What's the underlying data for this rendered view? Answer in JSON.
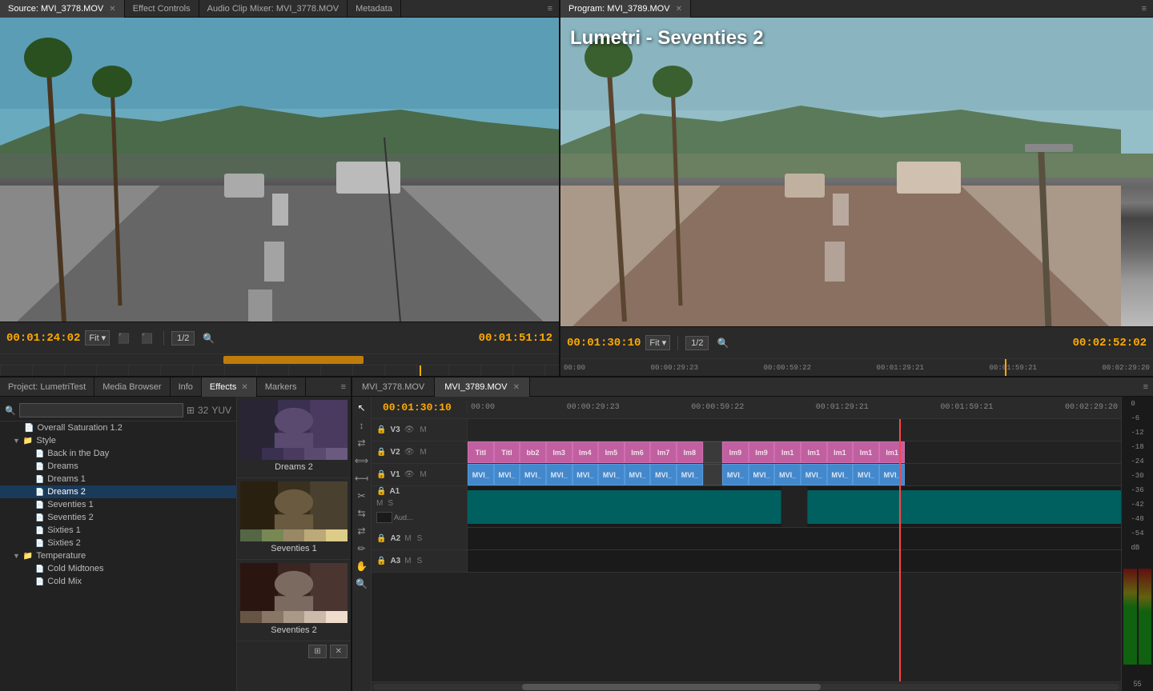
{
  "source_monitor": {
    "tabs": [
      {
        "label": "Source: MVI_3778.MOV",
        "active": true,
        "closeable": true
      },
      {
        "label": "Effect Controls",
        "active": false,
        "closeable": false
      },
      {
        "label": "Audio Clip Mixer: MVI_3778.MOV",
        "active": false,
        "closeable": false
      },
      {
        "label": "Metadata",
        "active": false,
        "closeable": false
      }
    ],
    "timecode_left": "00:01:24:02",
    "fit_label": "Fit",
    "fraction": "1/2",
    "timecode_right": "00:01:51:12"
  },
  "program_monitor": {
    "tabs": [
      {
        "label": "Program: MVI_3789.MOV",
        "active": true,
        "closeable": true
      }
    ],
    "timecode_left": "00:01:30:10",
    "fit_label": "Fit",
    "fraction": "1/2",
    "timecode_right": "00:02:52:02",
    "lumetri_label": "Lumetri - Seventies 2",
    "ruler_marks": [
      "00:00",
      "00:00:29:23",
      "00:00:59:22",
      "00:01:29:21",
      "00:01:59:21",
      "00:02:29:20"
    ]
  },
  "left_panel": {
    "tabs": [
      {
        "label": "Project: LumetriTest",
        "active": false
      },
      {
        "label": "Media Browser",
        "active": false
      },
      {
        "label": "Info",
        "active": false
      },
      {
        "label": "Effects",
        "active": true,
        "closeable": true
      },
      {
        "label": "Markers",
        "active": false
      }
    ],
    "search_placeholder": "",
    "tree": {
      "overall_saturation": "Overall Saturation 1.2",
      "style_folder": "Style",
      "items": [
        {
          "label": "Back in the Day",
          "indent": 3
        },
        {
          "label": "Dreams",
          "indent": 3
        },
        {
          "label": "Dreams 1",
          "indent": 3
        },
        {
          "label": "Dreams 2",
          "indent": 3
        },
        {
          "label": "Seventies 1",
          "indent": 3
        },
        {
          "label": "Seventies 2",
          "indent": 3
        },
        {
          "label": "Sixties 1",
          "indent": 3
        },
        {
          "label": "Sixties 2",
          "indent": 3
        }
      ],
      "temperature_folder": "Temperature",
      "temp_items": [
        {
          "label": "Cold Midtones",
          "indent": 3
        },
        {
          "label": "Cold Mix",
          "indent": 3
        }
      ]
    },
    "presets": [
      {
        "label": "Dreams 2",
        "gradient": "dreams"
      },
      {
        "label": "Seventies 1",
        "gradient": "seventies1"
      },
      {
        "label": "Seventies 2",
        "gradient": "seventies2"
      }
    ]
  },
  "timeline": {
    "tabs": [
      {
        "label": "MVI_3778.MOV",
        "active": false
      },
      {
        "label": "MVI_3789.MOV",
        "active": true,
        "closeable": true
      }
    ],
    "timecode": "00:01:30:10",
    "ruler_marks": [
      "00:00",
      "00:00:29:23",
      "00:00:59:22",
      "00:01:29:21",
      "00:01:59:21",
      "00:02:29:20"
    ],
    "tracks": [
      {
        "id": "V3",
        "type": "video",
        "label": "V3",
        "clips": []
      },
      {
        "id": "V2",
        "type": "video",
        "label": "V2",
        "clips": [
          {
            "label": "Titl",
            "color": "pink",
            "width": "4%"
          },
          {
            "label": "Titl",
            "color": "pink",
            "width": "4%"
          },
          {
            "label": "bb2",
            "color": "pink",
            "width": "4%"
          },
          {
            "label": "Im3",
            "color": "pink",
            "width": "4%"
          },
          {
            "label": "Im4",
            "color": "pink",
            "width": "4%"
          },
          {
            "label": "Im5",
            "color": "pink",
            "width": "4%"
          },
          {
            "label": "Im6",
            "color": "pink",
            "width": "4%"
          },
          {
            "label": "Im7",
            "color": "pink",
            "width": "4%"
          },
          {
            "label": "Im8",
            "color": "pink",
            "width": "4%"
          },
          {
            "label": "",
            "color": "dark",
            "width": "3%"
          },
          {
            "label": "Im9",
            "color": "pink",
            "width": "4%"
          },
          {
            "label": "Im9",
            "color": "pink",
            "width": "4%"
          },
          {
            "label": "Im1",
            "color": "pink",
            "width": "4%"
          },
          {
            "label": "Im1",
            "color": "pink",
            "width": "4%"
          },
          {
            "label": "Im1",
            "color": "pink",
            "width": "4%"
          },
          {
            "label": "Im1",
            "color": "pink",
            "width": "4%"
          },
          {
            "label": "Im1",
            "color": "pink",
            "width": "4%"
          }
        ]
      },
      {
        "id": "V1",
        "type": "video",
        "label": "V1",
        "clips": [
          {
            "label": "MVI_",
            "color": "blue",
            "width": "4%"
          },
          {
            "label": "MVI_",
            "color": "blue",
            "width": "4%"
          },
          {
            "label": "MVI_",
            "color": "blue",
            "width": "4%"
          },
          {
            "label": "MVI_",
            "color": "blue",
            "width": "4%"
          },
          {
            "label": "MVI_",
            "color": "blue",
            "width": "4%"
          },
          {
            "label": "MVI_",
            "color": "blue",
            "width": "4%"
          },
          {
            "label": "MVI_",
            "color": "blue",
            "width": "4%"
          },
          {
            "label": "MVI_",
            "color": "blue",
            "width": "4%"
          },
          {
            "label": "MVI_",
            "color": "blue",
            "width": "4%"
          },
          {
            "label": "",
            "color": "dark",
            "width": "3%"
          },
          {
            "label": "MVI_",
            "color": "blue",
            "width": "4%"
          },
          {
            "label": "MVI_",
            "color": "blue",
            "width": "4%"
          },
          {
            "label": "MVI_",
            "color": "blue",
            "width": "4%"
          },
          {
            "label": "MVI_",
            "color": "blue",
            "width": "4%"
          },
          {
            "label": "MVI_",
            "color": "blue",
            "width": "4%"
          },
          {
            "label": "MVI_",
            "color": "blue",
            "width": "4%"
          },
          {
            "label": "MVI_",
            "color": "blue",
            "width": "4%"
          }
        ]
      },
      {
        "id": "A1",
        "type": "audio",
        "label": "A1",
        "tall": true
      },
      {
        "id": "A2",
        "type": "audio",
        "label": "A2"
      },
      {
        "id": "A3",
        "type": "audio",
        "label": "A3"
      }
    ],
    "meter_labels": [
      "0",
      "-6",
      "-12",
      "-18",
      "-24",
      "-30",
      "-36",
      "-42",
      "-48",
      "-54",
      "dB"
    ]
  }
}
